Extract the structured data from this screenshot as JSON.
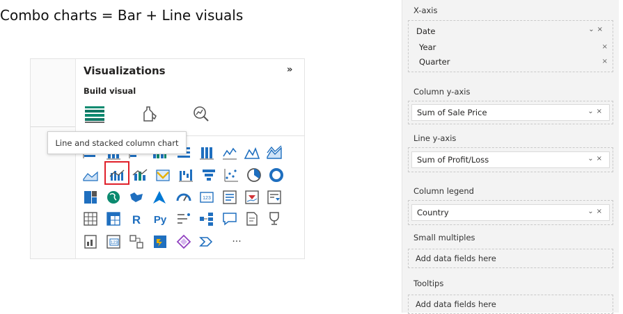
{
  "heading": "Combo charts = Bar + Line visuals",
  "viz_panel": {
    "title": "Visualizations",
    "collapse_glyph": "»",
    "build_visual_label": "Build visual",
    "tooltip": "Line and stacked column chart",
    "gallery_text": {
      "r": "R",
      "py": "Py",
      "more": "···"
    }
  },
  "fields_pane": {
    "x_axis": {
      "label": "X-axis",
      "field": "Date",
      "children": [
        "Year",
        "Quarter"
      ]
    },
    "column_y": {
      "label": "Column y-axis",
      "field": "Sum of Sale Price"
    },
    "line_y": {
      "label": "Line y-axis",
      "field": "Sum of Profit/Loss"
    },
    "column_legend": {
      "label": "Column legend",
      "field": "Country"
    },
    "small_multiples": {
      "label": "Small multiples",
      "placeholder": "Add data fields here"
    },
    "tooltips": {
      "label": "Tooltips",
      "placeholder": "Add data fields here"
    },
    "remove_glyph": "×",
    "chevron_glyph": "⌄"
  },
  "colors": {
    "accent_blue": "#1f6fbf",
    "teal": "#0b8a6f",
    "selection_red": "#e0202a"
  }
}
